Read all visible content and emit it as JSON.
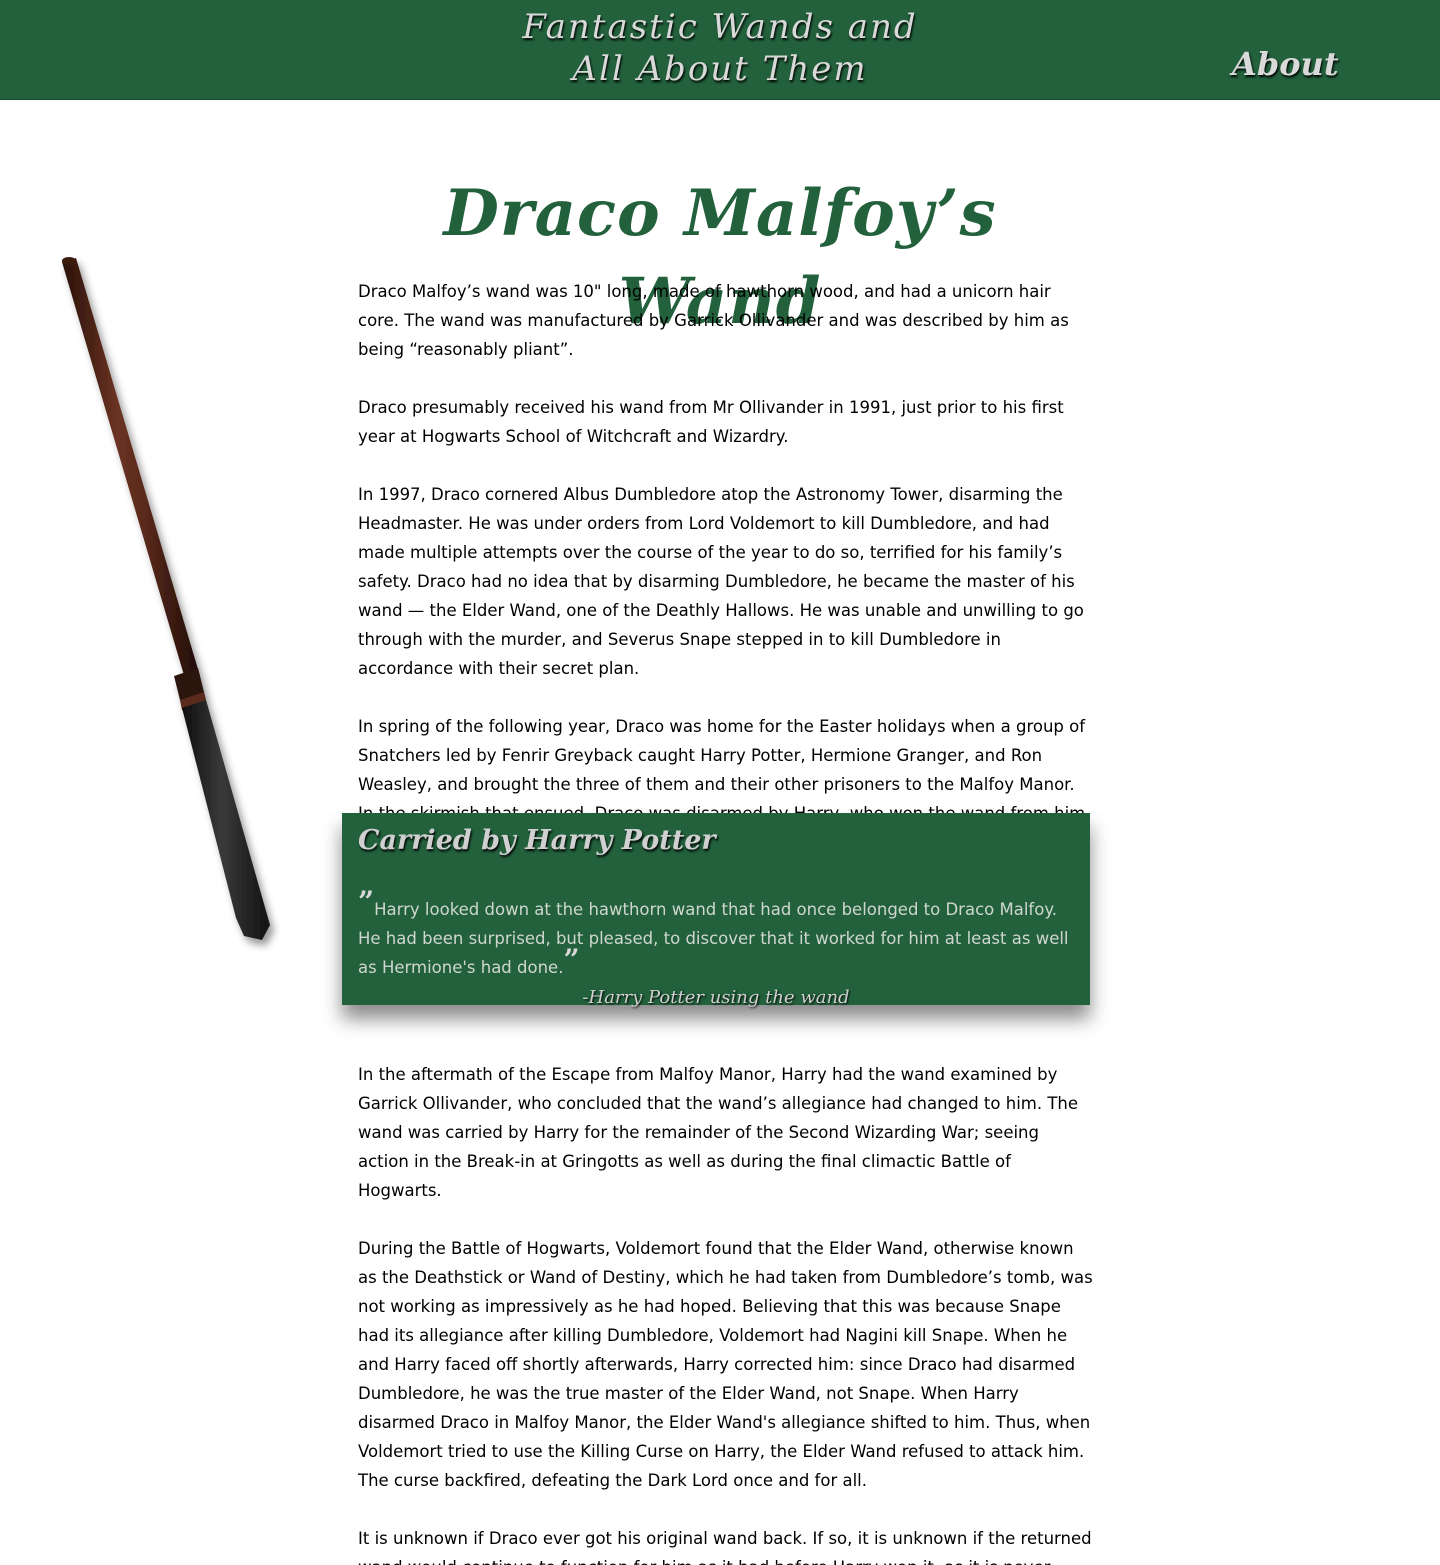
{
  "header": {
    "site_title_line1": "Fantastic Wands and",
    "site_title_line2": "All About Them",
    "about_label": "About",
    "background_color": "#22613c"
  },
  "page": {
    "title": "Draco Malfoy’s Wand",
    "title_color": "#22613c"
  },
  "paragraphs_top": [
    "Draco Malfoy’s wand was 10\" long, made of hawthorn wood, and had a unicorn hair core. The wand was manufactured by Garrick Ollivander and was described by him as being “reasonably pliant”.",
    "Draco presumably received his wand from Mr Ollivander in 1991, just prior to his first year at Hogwarts School of Witchcraft and Wizardry.",
    "In 1997, Draco cornered Albus Dumbledore atop the Astronomy Tower, disarming the Headmaster. He was under orders from Lord Voldemort to kill Dumbledore, and had made multiple attempts over the course of the year to do so, terrified for his family’s safety. Draco had no idea that by disarming Dumbledore, he became the master of his wand — the Elder Wand, one of the Deathly Hallows. He was unable and unwilling to go through with the murder, and Severus Snape stepped in to kill Dumbledore in accordance with their secret plan.",
    "In spring of the following year, Draco was home for the Easter holidays when a group of Snatchers led by Fenrir Greyback caught Harry Potter, Hermione Granger, and Ron Weasley, and brought the three of them and their other prisoners to the Malfoy Manor. In the skirmish that ensued, Draco was disarmed by Harry, who won the wand from him. Draco's mother gave him her wand to use."
  ],
  "quote": {
    "heading": "Carried by Harry Potter",
    "open_mark": "”",
    "text": "Harry looked down at the hawthorn wand that had once belonged to Draco Malfoy. He had been surprised, but pleased, to discover that it worked for him at least as well as Hermione's had done.",
    "close_mark": "”",
    "attribution": "-Harry Potter using the wand"
  },
  "paragraphs_bottom": [
    "In the aftermath of the Escape from Malfoy Manor, Harry had the wand examined by Garrick Ollivander, who concluded that the wand’s allegiance had changed to him. The wand was carried by Harry for the remainder of the Second Wizarding War; seeing action in the Break-in at Gringotts as well as during the final climactic Battle of Hogwarts.",
    "During the Battle of Hogwarts, Voldemort found that the Elder Wand, otherwise known as the Deathstick or Wand of Destiny, which he had taken from Dumbledore’s tomb, was not working as impressively as he had hoped. Believing that this was because Snape had its allegiance after killing Dumbledore, Voldemort had Nagini kill Snape. When he and Harry faced off shortly afterwards, Harry corrected him: since Draco had disarmed Dumbledore, he was the true master of the Elder Wand, not Snape. When Harry disarmed Draco in Malfoy Manor, the Elder Wand's allegiance shifted to him. Thus, when Voldemort tried to use the Killing Curse on Harry, the Elder Wand refused to attack him. The curse backfired, defeating the Dark Lord once and for all.",
    "It is unknown if Draco ever got his original wand back. If so, it is unknown if the returned wand would continue to function for him as it had before Harry won it, as it is never stated how a wand that has been won behaves towards its original master afterwards."
  ]
}
